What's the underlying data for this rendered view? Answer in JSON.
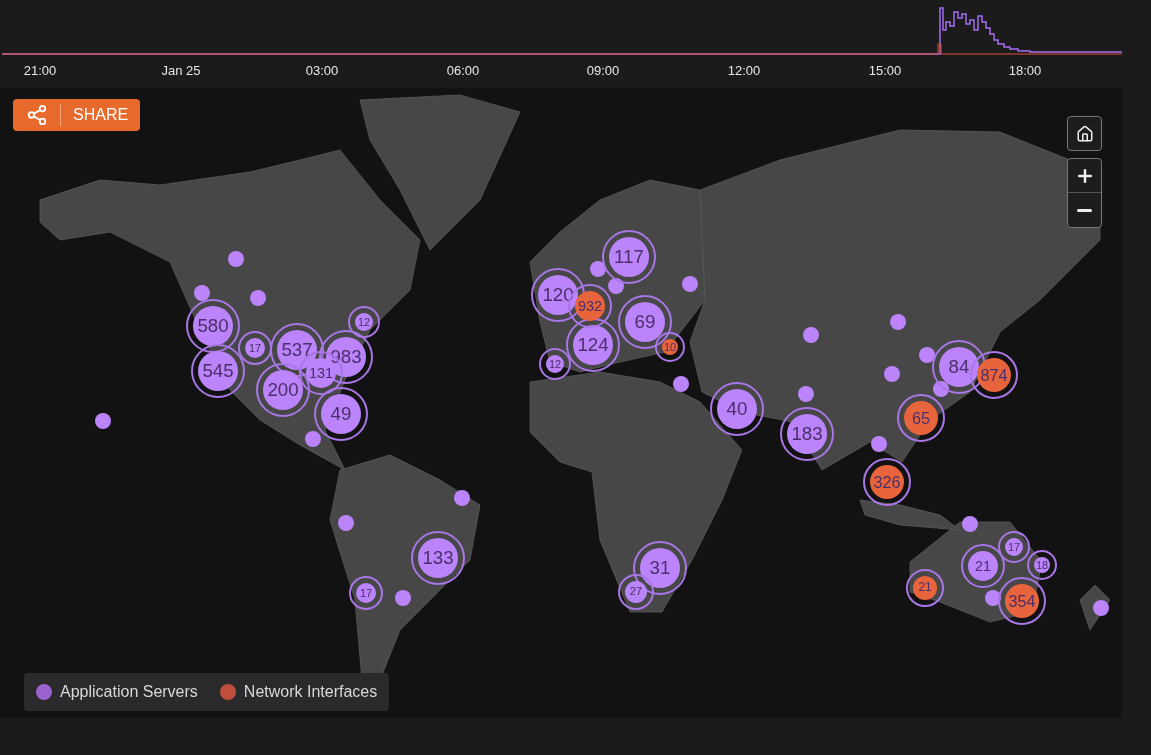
{
  "timeline": {
    "ticks": [
      "21:00",
      "Jan 25",
      "03:00",
      "06:00",
      "09:00",
      "12:00",
      "15:00",
      "18:00"
    ]
  },
  "share_button": {
    "label": "SHARE"
  },
  "markers": [
    {
      "kind": "cluster",
      "label": "580",
      "color": "#bb84fb"
    },
    {
      "kind": "cluster",
      "label": "545",
      "color": "#bb84fb"
    },
    {
      "kind": "cluster",
      "label": "17",
      "color": "#bb84fb"
    },
    {
      "kind": "cluster",
      "label": "537",
      "color": "#bb84fb"
    },
    {
      "kind": "cluster",
      "label": "983",
      "color": "#bb84fb"
    },
    {
      "kind": "cluster",
      "label": "131",
      "color": "#bb84fb"
    },
    {
      "kind": "cluster",
      "label": "200",
      "color": "#bb84fb"
    },
    {
      "kind": "cluster",
      "label": "49",
      "color": "#bb84fb"
    },
    {
      "kind": "cluster",
      "label": "12",
      "color": "#bb84fb"
    },
    {
      "kind": "cluster",
      "label": "133",
      "color": "#bb84fb"
    },
    {
      "kind": "cluster",
      "label": "17",
      "color": "#bb84fb"
    },
    {
      "kind": "cluster",
      "label": "120",
      "color": "#bb84fb"
    },
    {
      "kind": "cluster",
      "label": "932",
      "color": "#e8643c"
    },
    {
      "kind": "cluster",
      "label": "117",
      "color": "#bb84fb"
    },
    {
      "kind": "cluster",
      "label": "69",
      "color": "#bb84fb"
    },
    {
      "kind": "cluster",
      "label": "124",
      "color": "#bb84fb"
    },
    {
      "kind": "cluster",
      "label": "12",
      "color": "#bb84fb"
    },
    {
      "kind": "cluster",
      "label": "10",
      "color": "#e8643c"
    },
    {
      "kind": "cluster",
      "label": "40",
      "color": "#bb84fb"
    },
    {
      "kind": "cluster",
      "label": "183",
      "color": "#bb84fb"
    },
    {
      "kind": "cluster",
      "label": "84",
      "color": "#bb84fb"
    },
    {
      "kind": "cluster",
      "label": "874",
      "color": "#e8643c"
    },
    {
      "kind": "cluster",
      "label": "65",
      "color": "#e8643c"
    },
    {
      "kind": "cluster",
      "label": "326",
      "color": "#e8643c"
    },
    {
      "kind": "cluster",
      "label": "31",
      "color": "#bb84fb"
    },
    {
      "kind": "cluster",
      "label": "27",
      "color": "#bb84fb"
    },
    {
      "kind": "cluster",
      "label": "21",
      "color": "#bb84fb"
    },
    {
      "kind": "cluster",
      "label": "17",
      "color": "#bb84fb"
    },
    {
      "kind": "cluster",
      "label": "18",
      "color": "#bb84fb"
    },
    {
      "kind": "cluster",
      "label": "21",
      "color": "#e8643c"
    },
    {
      "kind": "cluster",
      "label": "354",
      "color": "#e8643c"
    },
    {
      "kind": "dot",
      "color": "#bb84fb"
    },
    {
      "kind": "dot",
      "color": "#bb84fb"
    },
    {
      "kind": "dot",
      "color": "#bb84fb"
    },
    {
      "kind": "dot",
      "color": "#bb84fb"
    },
    {
      "kind": "dot",
      "color": "#bb84fb"
    },
    {
      "kind": "dot",
      "color": "#bb84fb"
    },
    {
      "kind": "dot",
      "color": "#bb84fb"
    },
    {
      "kind": "dot",
      "color": "#bb84fb"
    },
    {
      "kind": "dot",
      "color": "#bb84fb"
    },
    {
      "kind": "dot",
      "color": "#bb84fb"
    },
    {
      "kind": "dot",
      "color": "#bb84fb"
    },
    {
      "kind": "dot",
      "color": "#bb84fb"
    },
    {
      "kind": "dot",
      "color": "#bb84fb"
    },
    {
      "kind": "dot",
      "color": "#bb84fb"
    },
    {
      "kind": "dot",
      "color": "#bb84fb"
    },
    {
      "kind": "dot",
      "color": "#bb84fb"
    },
    {
      "kind": "dot",
      "color": "#bb84fb"
    },
    {
      "kind": "dot",
      "color": "#bb84fb"
    },
    {
      "kind": "dot",
      "color": "#bb84fb"
    },
    {
      "kind": "dot",
      "color": "#bb84fb"
    },
    {
      "kind": "dot",
      "color": "#bb84fb"
    },
    {
      "kind": "dot",
      "color": "#bb84fb"
    }
  ],
  "legend": [
    {
      "label": "Application Servers",
      "color": "#9b62cf"
    },
    {
      "label": "Network Interfaces",
      "color": "#c0503c"
    }
  ]
}
